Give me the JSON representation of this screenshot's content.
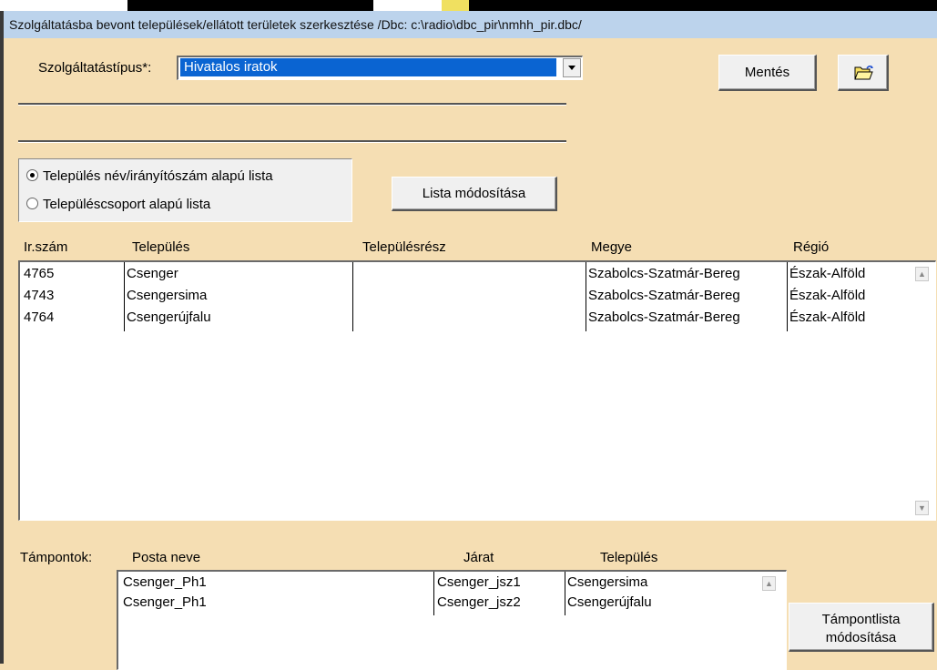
{
  "window": {
    "title": "Szolgáltatásba bevont települések/ellátott területek szerkesztése  /Dbc: c:\\radio\\dbc_pir\\nmhh_pir.dbc/"
  },
  "service": {
    "label": "Szolgáltatástípus*:",
    "selected": "Hivatalos iratok"
  },
  "buttons": {
    "save": "Mentés",
    "modify_list": "Lista módosítása",
    "modify_points_line1": "Támpontlista",
    "modify_points_line2": "módosítása"
  },
  "list_mode": {
    "options": [
      {
        "label": "Település név/irányítószám alapú lista",
        "selected": true
      },
      {
        "label": "Településcsoport alapú lista",
        "selected": false
      }
    ]
  },
  "settlements": {
    "columns": [
      "Ir.szám",
      "Település",
      "Településrész",
      "Megye",
      "Régió"
    ],
    "rows": [
      {
        "zip": "4765",
        "name": "Csenger",
        "part": "",
        "county": "Szabolcs-Szatmár-Bereg",
        "region": "Észak-Alföld"
      },
      {
        "zip": "4743",
        "name": "Csengersima",
        "part": "",
        "county": "Szabolcs-Szatmár-Bereg",
        "region": "Észak-Alföld"
      },
      {
        "zip": "4764",
        "name": "Csengerújfalu",
        "part": "",
        "county": "Szabolcs-Szatmár-Bereg",
        "region": "Észak-Alföld"
      }
    ]
  },
  "points": {
    "label": "Támpontok:",
    "columns": [
      "Posta neve",
      "Járat",
      "Település"
    ],
    "rows": [
      {
        "post": "Csenger_Ph1",
        "route": "Csenger_jsz1",
        "settlement": "Csengersima"
      },
      {
        "post": "Csenger_Ph1",
        "route": "Csenger_jsz2",
        "settlement": "Csengerújfalu"
      }
    ]
  },
  "icons": {
    "dropdown": "chevron-down-icon",
    "folder": "open-folder-icon",
    "scroll_up": "scroll-up-arrow-icon",
    "scroll_down": "scroll-down-arrow-icon"
  },
  "colors": {
    "background": "#f5deb3",
    "title_bar": "#bcd3ec",
    "selection": "#0a64d2"
  }
}
